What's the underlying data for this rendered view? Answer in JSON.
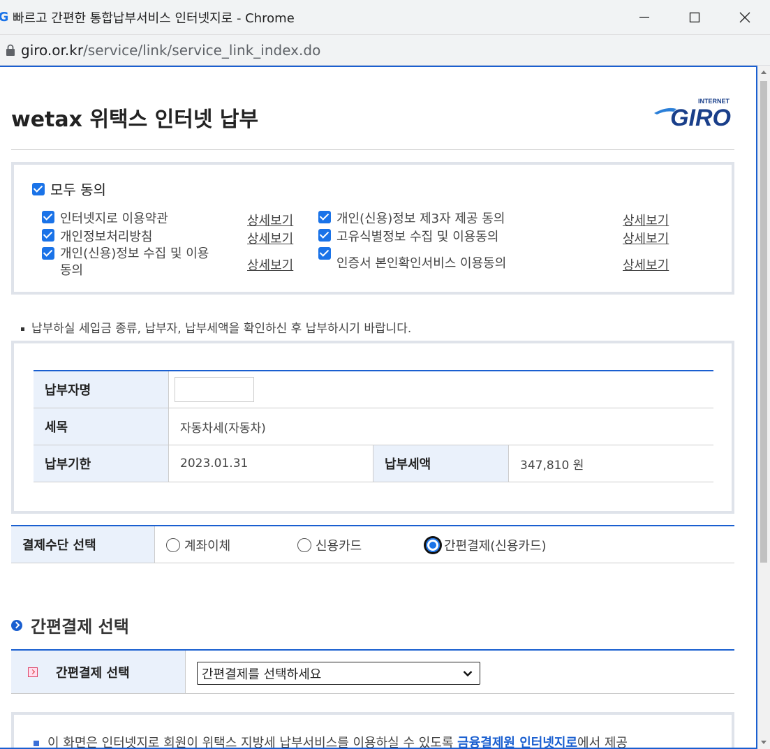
{
  "window": {
    "title": "빠르고 간편한 통합납부서비스 인터넷지로 - Chrome",
    "logo_letter": "G",
    "url_domain": "giro.or.kr",
    "url_path": "/service/link/service_link_index.do"
  },
  "page": {
    "heading": "wetax 위택스 인터넷 납부",
    "logo": {
      "top": "INTERNET",
      "main": "GIRO"
    }
  },
  "agreement": {
    "all_label": "모두 동의",
    "detail_label": "상세보기",
    "left_items": [
      {
        "label": "인터넷지로 이용약관"
      },
      {
        "label": "개인정보처리방침"
      },
      {
        "label_line1": "개인(신용)정보 수집 및 이용",
        "label_line2": "동의"
      }
    ],
    "right_items": [
      {
        "label": "개인(신용)정보 제3자 제공 동의"
      },
      {
        "label": "고유식별정보 수집 및 이용동의"
      },
      {
        "label": "인증서 본인확인서비스 이용동의"
      }
    ]
  },
  "notice": "납부하실 세입금 종류, 납부자, 납부세액을 확인하신 후 납부하시기 바랍니다.",
  "info": {
    "payer_name_label": "납부자명",
    "payer_name_value": "",
    "tax_item_label": "세목",
    "tax_item_value": "자동차세(자동차)",
    "due_label": "납부기한",
    "due_value": "2023.01.31",
    "amount_label": "납부세액",
    "amount_value": "347,810 원"
  },
  "payment": {
    "label": "결제수단 선택",
    "options": [
      "계좌이체",
      "신용카드",
      "간편결제(신용카드)"
    ],
    "selected": "간편결제(신용카드)"
  },
  "easy_pay": {
    "section_title": "간편결제 선택",
    "label": "간편결제 선택",
    "select_value": "간편결제를 선택하세요"
  },
  "footer": {
    "text_prefix": "이 화면은 인터넷지로 회원이 위택스 지방세 납부서비스를 이용하실 수 있도록 ",
    "text_highlight": "금융결제원 인터넷지로",
    "text_suffix": "에서 제공"
  },
  "colors": {
    "accent": "#1a5fd0",
    "checkbox": "#1a73e8",
    "header_bg": "#eaf1fb"
  }
}
